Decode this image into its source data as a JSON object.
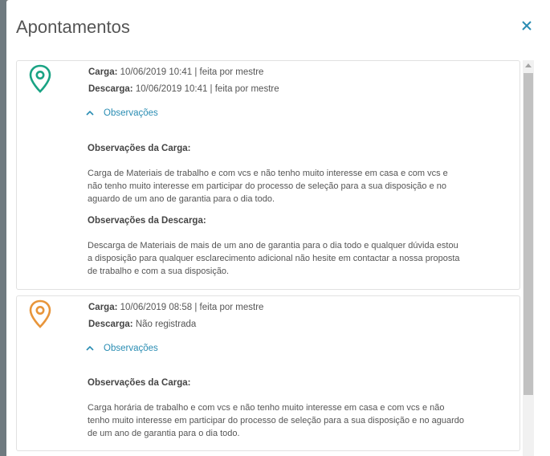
{
  "modal": {
    "title": "Apontamentos",
    "close_label": "×"
  },
  "records": [
    {
      "pin_color": "#1aa384",
      "carga_label": "Carga:",
      "carga_value": "10/06/2019 10:41 | feita por mestre",
      "descarga_label": "Descarga:",
      "descarga_value": "10/06/2019 10:41 | feita por mestre",
      "obs_toggle_label": "Observações",
      "obs_carga_title": "Observações da Carga:",
      "obs_carga_text": "Carga de Materiais de trabalho e com vcs e não tenho muito interesse em casa e com vcs e não tenho muito interesse em participar do processo de seleção para a sua disposição e no aguardo de um ano de garantia para o dia todo.",
      "obs_descarga_title": "Observações da Descarga:",
      "obs_descarga_text": "Descarga de Materiais de mais de um ano de garantia para o dia todo e qualquer dúvida estou a disposição para qualquer esclarecimento adicional não hesite em contactar a nossa proposta de trabalho e com a sua disposição."
    },
    {
      "pin_color": "#e8953a",
      "carga_label": "Carga:",
      "carga_value": "10/06/2019 08:58 | feita por mestre",
      "descarga_label": "Descarga:",
      "descarga_value": "Não registrada",
      "obs_toggle_label": "Observações",
      "obs_carga_title": "Observações da Carga:",
      "obs_carga_text": "Carga horária de trabalho e com vcs e não tenho muito interesse em casa e com vcs e não tenho muito interesse em participar do processo de seleção para a sua disposição e no aguardo de um ano de garantia para o dia todo."
    }
  ]
}
